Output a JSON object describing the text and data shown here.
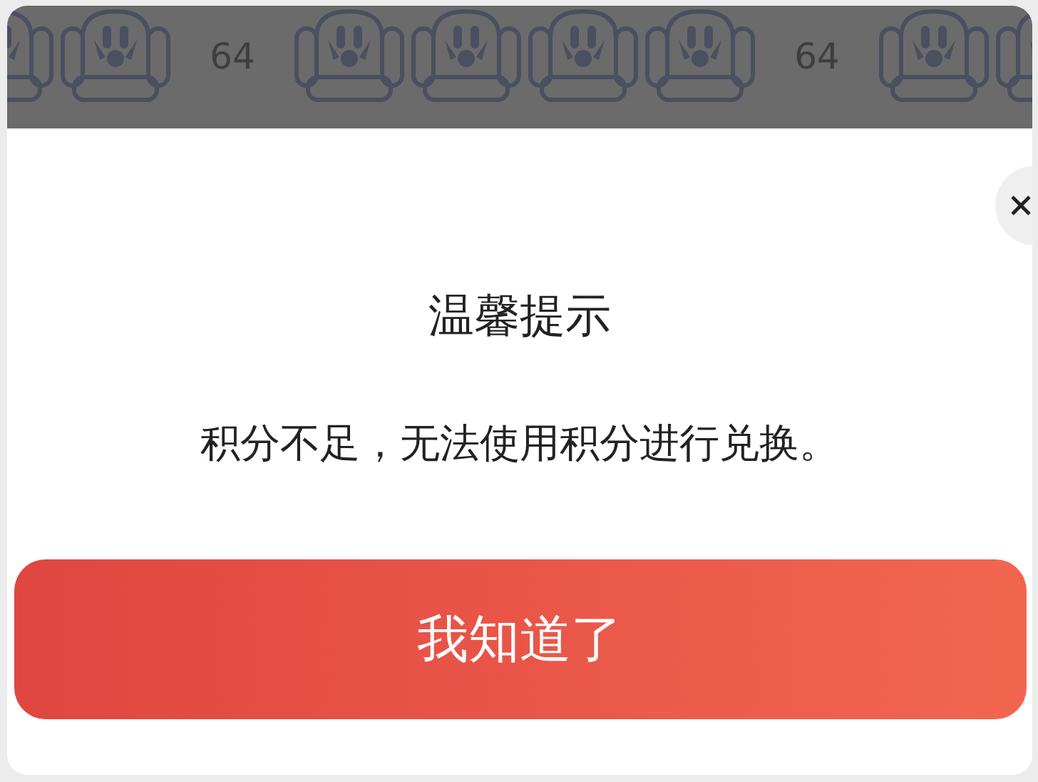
{
  "seat_row": [
    {
      "kind": "seat"
    },
    {
      "kind": "seat"
    },
    {
      "kind": "number",
      "label": "64"
    },
    {
      "kind": "seat"
    },
    {
      "kind": "seat"
    },
    {
      "kind": "seat"
    },
    {
      "kind": "seat"
    },
    {
      "kind": "number",
      "label": "64"
    },
    {
      "kind": "seat"
    },
    {
      "kind": "seat"
    }
  ],
  "dialog": {
    "title": "温馨提示",
    "message": "积分不足，无法使用积分进行兑换。",
    "button": "我知道了"
  }
}
